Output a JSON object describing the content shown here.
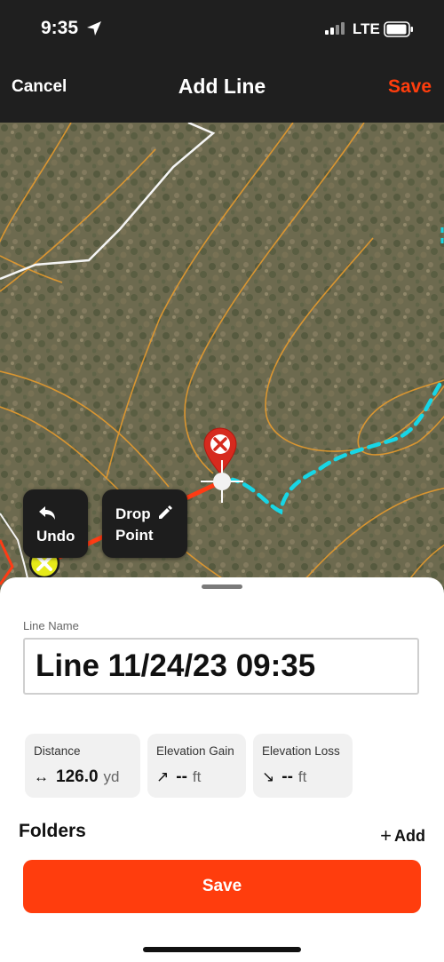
{
  "status_bar": {
    "time": "9:35",
    "network": "LTE"
  },
  "nav": {
    "cancel_label": "Cancel",
    "title": "Add Line",
    "save_label": "Save"
  },
  "map_controls": {
    "undo_label": "Undo",
    "drop_point_line1": "Drop",
    "drop_point_line2": "Point"
  },
  "sheet": {
    "line_name_label": "Line Name",
    "line_name_value": "Line 11/24/23 09:35",
    "stats": [
      {
        "title": "Distance",
        "value": "126.0",
        "unit": "yd"
      },
      {
        "title": "Elevation Gain",
        "value": "--",
        "unit": "ft"
      },
      {
        "title": "Elevation Loss",
        "value": "--",
        "unit": "ft"
      }
    ],
    "folders_label": "Folders",
    "add_label": "Add",
    "save_button_label": "Save"
  },
  "colors": {
    "accent": "#ff3d0d",
    "path": "#ff3b14",
    "trail": "#17d6e6",
    "contour": "#e59a2e"
  },
  "icons": [
    "location-arrow-icon",
    "signal-icon",
    "battery-icon",
    "undo-icon",
    "pencil-icon",
    "start-marker-icon",
    "end-marker-icon",
    "crosshair-icon",
    "horizontal-arrows-icon",
    "arrow-up-right-icon",
    "arrow-down-right-icon",
    "plus-icon"
  ]
}
